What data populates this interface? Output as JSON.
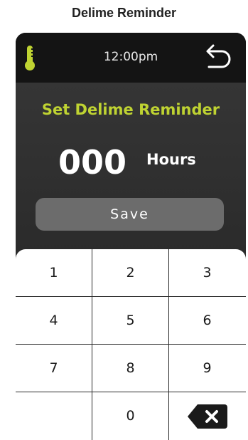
{
  "page": {
    "title": "Delime Reminder"
  },
  "status_bar": {
    "time": "12:00pm",
    "left_icon": "thermometer-icon",
    "right_icon": "back-arrow-icon"
  },
  "screen": {
    "heading": "Set Delime Reminder",
    "hours_value": "000",
    "hours_unit": "Hours",
    "save_label": "Save"
  },
  "keypad": {
    "keys": [
      "1",
      "2",
      "3",
      "4",
      "5",
      "6",
      "7",
      "8",
      "9",
      "",
      "0",
      "⌫"
    ],
    "backspace_icon": "backspace-icon"
  },
  "colors": {
    "accent": "#bfd332",
    "device_background": "#2b2b2b",
    "status_bar_background": "#141414",
    "save_button": "#6c6c6c",
    "keypad_background": "#ffffff"
  }
}
